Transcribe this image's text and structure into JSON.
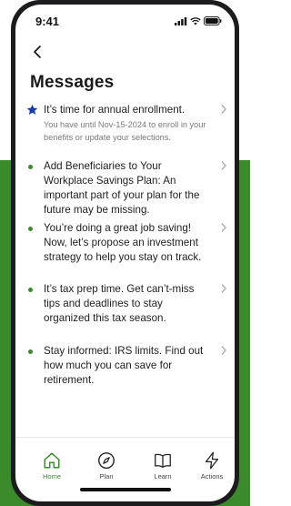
{
  "status": {
    "time": "9:41"
  },
  "page": {
    "title": "Messages"
  },
  "colors": {
    "accent": "#3b8a2c",
    "star": "#1a3ea8",
    "background_band": "#3b8a2c"
  },
  "messages": [
    {
      "marker": "star-icon",
      "text": "It’s time for annual enrollment.",
      "subtext": "You have until Nov-15-2024 to enroll in your benefits or update your selections."
    },
    {
      "marker": "dot",
      "text": "Add Beneficiaries to Your Workplace Savings Plan: An important part of your plan for the future may be missing."
    },
    {
      "marker": "dot",
      "text": "You’re doing a great job saving! Now, let’s propose an investment strategy to help you stay on track."
    },
    {
      "marker": "dot",
      "text": "It’s tax prep time. Get can’t-miss tips and deadlines to stay organized this tax season."
    },
    {
      "marker": "dot",
      "text": "Stay informed: IRS limits. Find out how much you can save for retirement."
    }
  ],
  "tabbar": {
    "items": [
      {
        "label": "Home",
        "icon": "home-icon",
        "active": true
      },
      {
        "label": "Plan",
        "icon": "compass-icon",
        "active": false
      },
      {
        "label": "Learn",
        "icon": "book-icon",
        "active": false
      },
      {
        "label": "Actions",
        "icon": "lightning-icon",
        "active": false
      }
    ]
  }
}
